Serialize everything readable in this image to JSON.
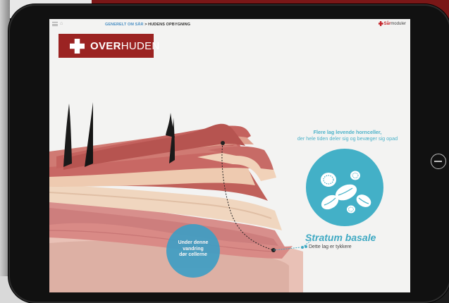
{
  "topbar": {
    "breadcrumb_section": "GENERELT OM SÅR",
    "breadcrumb_separator": " > ",
    "breadcrumb_current": "HUDENS OPBYGNING",
    "brand_bold": "Sår",
    "brand_rest": "moduler"
  },
  "banner": {
    "title_bold": "OVER",
    "title_rest": "HUDEN"
  },
  "callout": {
    "line1": "Flere lag levende hornceller,",
    "line2": "der hele tiden deler sig og bevæger sig opad"
  },
  "stratum": {
    "name": "Stratum basale",
    "description": "Dette lag er tykkere"
  },
  "blue_circle": {
    "line1": "Under denne",
    "line2": "vandring",
    "line3": "dør cellerne"
  },
  "icons": {
    "menu": "menu-icon",
    "home": "home-icon",
    "brand_cross": "cross-icon",
    "device_home": "power-icon"
  },
  "colors": {
    "banner_red": "#9b2322",
    "accent_blue": "#43b0c7",
    "screen_bg": "#f3f3f2"
  }
}
